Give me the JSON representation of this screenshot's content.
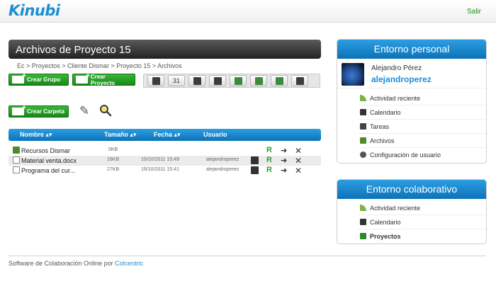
{
  "header": {
    "logo": "Kinubi",
    "logout": "Salir"
  },
  "page": {
    "title": "Archivos de Proyecto 15",
    "breadcrumb": "Ec > Proyectos > Cliente Dismar > Proyecto 15 > Archivos"
  },
  "buttons": {
    "create_group": "Crear Grupo",
    "create_project": "Crear Proyecto",
    "create_folder": "Crear Carpeta"
  },
  "toolbar": {
    "icons": [
      "calculator-icon",
      "calendar-icon",
      "chat-icon",
      "document-icon",
      "clapper-icon",
      "folder-icon",
      "users-icon",
      "settings-icon"
    ],
    "calendar_label": "31"
  },
  "table": {
    "columns": [
      "Nombre",
      "Tamaño",
      "Fecha",
      "Usuario"
    ],
    "rows": [
      {
        "name": "Recursos Dismar",
        "size": "0KB",
        "date": "",
        "user": "",
        "type": "folder"
      },
      {
        "name": "Material venta.docx",
        "size": "16KB",
        "date": "15/10/2011 15:49",
        "user": "alejandroperez",
        "type": "file"
      },
      {
        "name": "Programa del cur...",
        "size": "27KB",
        "date": "15/10/2011 15:41",
        "user": "alejandroperez",
        "type": "file"
      }
    ],
    "action_r": "R"
  },
  "personal": {
    "title": "Entorno personal",
    "full_name": "Alejandro Pérez",
    "username": "alejandroperez",
    "menu": [
      "Actividad reciente",
      "Calendario",
      "Tareas",
      "Archivos",
      "Configuración de usuario"
    ]
  },
  "collab": {
    "title": "Entorno colaborativo",
    "menu": [
      "Actividad reciente",
      "Calendario",
      "Proyectos"
    ]
  },
  "footer": {
    "text": "Software de Colaboración Online por",
    "link": "Colcentric"
  },
  "colors": {
    "accent_blue": "#1c8fd3",
    "accent_green": "#158a15",
    "title_dark": "#222222"
  }
}
